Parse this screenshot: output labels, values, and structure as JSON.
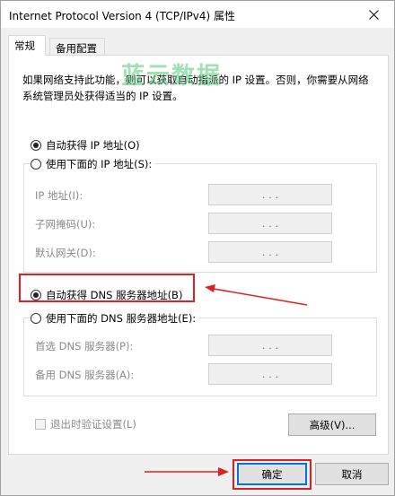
{
  "window": {
    "title": "Internet Protocol Version 4 (TCP/IPv4) 属性",
    "close_glyph": "close-icon"
  },
  "tabs": [
    {
      "label": "常规",
      "active": true
    },
    {
      "label": "备用配置",
      "active": false
    }
  ],
  "description": "如果网络支持此功能，则可以获取自动指派的 IP 设置。否则，你需要从网络系统管理员处获得适当的 IP 设置。",
  "watermark": "蓝云数据",
  "ip_section": {
    "auto_label": "自动获得 IP 地址(O)",
    "auto_checked": true,
    "manual_label": "使用下面的 IP 地址(S):",
    "manual_checked": false,
    "fields": [
      {
        "label": "IP 地址(I):",
        "value": ".     .     ."
      },
      {
        "label": "子网掩码(U):",
        "value": ".     .     ."
      },
      {
        "label": "默认网关(D):",
        "value": ".     .     ."
      }
    ]
  },
  "dns_section": {
    "auto_label": "自动获得 DNS 服务器地址(B)",
    "auto_checked": true,
    "manual_label": "使用下面的 DNS 服务器地址(E):",
    "manual_checked": false,
    "fields": [
      {
        "label": "首选 DNS 服务器(P):",
        "value": ".     .     ."
      },
      {
        "label": "备用 DNS 服务器(A):",
        "value": ".     .     ."
      }
    ]
  },
  "validate_label": "退出时验证设置(L)",
  "validate_checked": false,
  "buttons": {
    "advanced": "高级(V)...",
    "ok": "确定",
    "cancel": "取消"
  },
  "colors": {
    "highlight": "#e02020",
    "watermark": "#50c878",
    "focus": "#0078d7"
  }
}
